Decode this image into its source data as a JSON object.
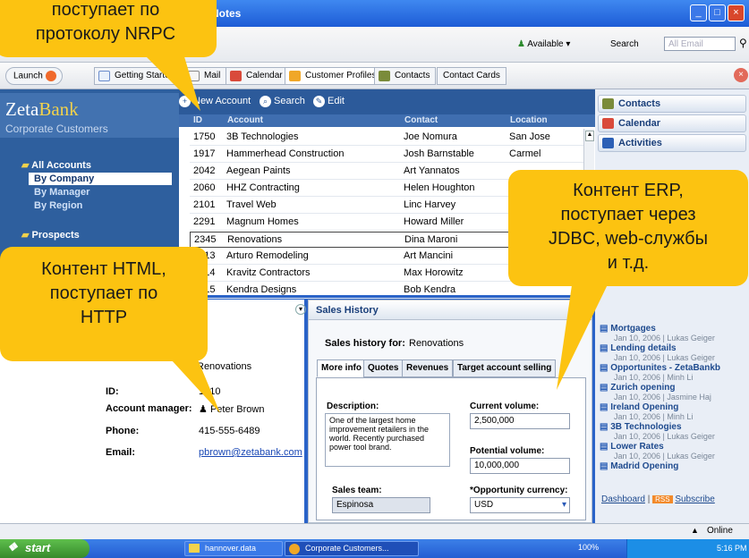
{
  "window": {
    "title": "Notes"
  },
  "menubar": {
    "status_label": "Available",
    "search_label": "Search",
    "search_placeholder": "All Email"
  },
  "toolbar": {
    "launch_label": "Launch",
    "tabs": [
      {
        "label": "Getting Started"
      },
      {
        "label": "Mail"
      },
      {
        "label": "Calendar"
      },
      {
        "label": "Customer Profiles"
      },
      {
        "label": "Contacts"
      },
      {
        "label": "Contact Cards"
      }
    ]
  },
  "brand": {
    "name_a": "Zeta",
    "name_b": "Bank",
    "subtitle": "Corporate Customers"
  },
  "nav": {
    "all_accounts": "All Accounts",
    "by_company": "By Company",
    "by_manager": "By Manager",
    "by_region": "By Region",
    "prospects": "Prospects"
  },
  "grid_toolbar": {
    "new_account": "New Account",
    "search": "Search",
    "edit": "Edit"
  },
  "grid": {
    "headers": [
      "ID",
      "Account",
      "Contact",
      "Location"
    ],
    "rows": [
      {
        "id": "1750",
        "account": "3B Technologies",
        "contact": "Joe Nomura",
        "location": "San Jose"
      },
      {
        "id": "1917",
        "account": "Hammerhead Construction",
        "contact": "Josh Barnstable",
        "location": "Carmel"
      },
      {
        "id": "2042",
        "account": "Aegean Paints",
        "contact": "Art Yannatos",
        "location": ""
      },
      {
        "id": "2060",
        "account": "HHZ Contracting",
        "contact": "Helen Houghton",
        "location": ""
      },
      {
        "id": "2101",
        "account": "Travel Web",
        "contact": "Linc Harvey",
        "location": ""
      },
      {
        "id": "2291",
        "account": "Magnum Homes",
        "contact": "Howard Miller",
        "location": ""
      },
      {
        "id": "2345",
        "account": "Renovations",
        "contact": "Dina Maroni",
        "location": ""
      },
      {
        "id": "2413",
        "account": "Arturo Remodeling",
        "contact": "Art Mancini",
        "location": ""
      },
      {
        "id": "2414",
        "account": "Kravitz Contractors",
        "contact": "Max Horowitz",
        "location": ""
      },
      {
        "id": "2415",
        "account": "Kendra Designs",
        "contact": "Bob Kendra",
        "location": ""
      }
    ]
  },
  "right_panel": {
    "contacts": "Contacts",
    "calendar": "Calendar",
    "activities": "Activities",
    "feed": [
      {
        "title": "Mortgages",
        "sub": "Jan 10, 2006 | Lukas Geiger"
      },
      {
        "title": "Lending details",
        "sub": "Jan 10, 2006 | Lukas Geiger"
      },
      {
        "title": "Opportunites - ZetaBankb",
        "sub": "Jan 10, 2006 | Minh Li"
      },
      {
        "title": "Zurich opening",
        "sub": "Jan 10, 2006 | Jasmine Haj"
      },
      {
        "title": "Ireland Opening",
        "sub": "Jan 10, 2006 | Minh Li"
      },
      {
        "title": "3B Technologies",
        "sub": "Jan 10, 2006 | Lukas Geiger"
      },
      {
        "title": "Lower Rates",
        "sub": "Jan 10, 2006 | Lukas Geiger"
      },
      {
        "title": "Madrid Opening",
        "sub": ""
      }
    ],
    "dashboard": "Dashboard",
    "subscribe": "Subscribe"
  },
  "details": {
    "account_value": "Renovations",
    "id_label": "ID:",
    "id_value": "1010",
    "manager_label": "Account manager:",
    "manager_value": "Peter Brown",
    "phone_label": "Phone:",
    "phone_value": "415-555-6489",
    "email_label": "Email:",
    "email_value": "pbrown@zetabank.com"
  },
  "sales": {
    "title": "Sales History",
    "for_label": "Sales history for:",
    "for_value": "Renovations",
    "tabs": [
      "More info",
      "Quotes",
      "Revenues",
      "Target account selling"
    ],
    "description_label": "Description:",
    "description_text": "One of the largest home improvement retailers in the world. Recently purchased power tool brand.",
    "current_label": "Current volume:",
    "current_value": "2,500,000",
    "potential_label": "Potential volume:",
    "potential_value": "10,000,000",
    "team_label": "Sales team:",
    "team_value": "Espinosa",
    "currency_label": "*Opportunity currency:",
    "currency_value": "USD"
  },
  "status": {
    "online": "Online"
  },
  "taskbar": {
    "start": "start",
    "item1": "hannover.data",
    "item2": "Corporate Customers...",
    "zoom": "100%",
    "clock": "5:16 PM"
  },
  "callouts": {
    "nrpc_line1": "поступает по",
    "nrpc_line2": "протоколу NRPC",
    "erp_line1": "Контент ERP,",
    "erp_line2": "поступает через",
    "erp_line3": "JDBC, web-службы",
    "erp_line4": "и т.д.",
    "html_line1": "Контент HTML,",
    "html_line2": "поступает по",
    "html_line3": "HTTP"
  }
}
